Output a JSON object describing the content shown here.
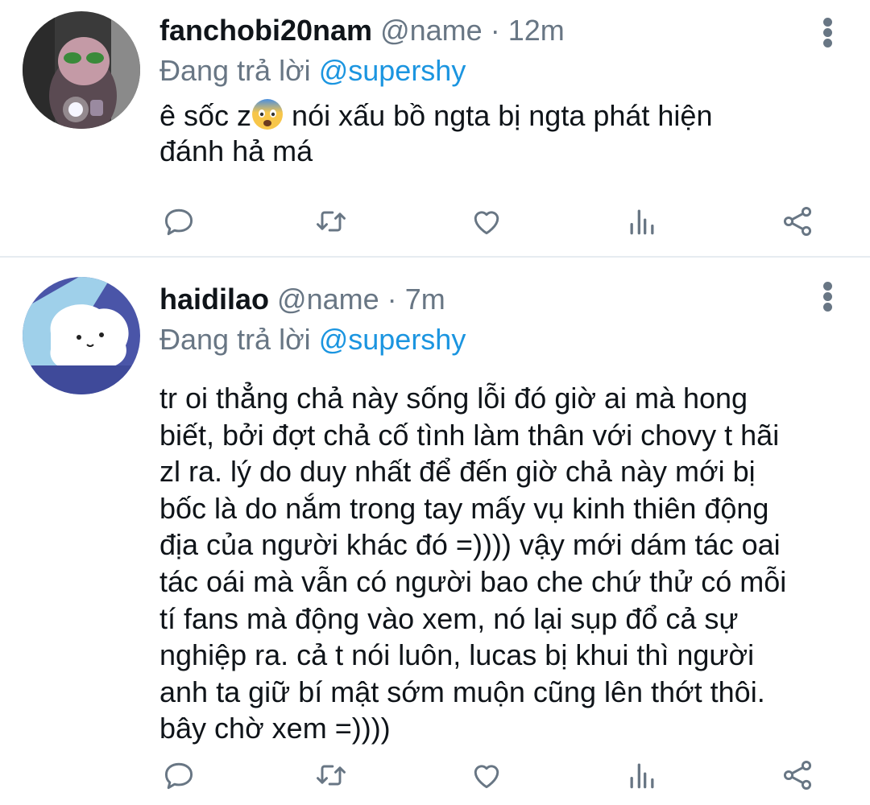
{
  "tweets": [
    {
      "username": "fanchobi20nam",
      "handle": "@name",
      "separator": "·",
      "time": "12m",
      "replying_prefix": "Đang trả lời",
      "replying_to": "@supershy",
      "text_before_emoji": "ê sốc z",
      "emoji": "fearful-face-emoji",
      "text_after_emoji": " nói xấu bồ ngta bị ngta phát hiện\nđánh hả má"
    },
    {
      "username": "haidilao",
      "handle": "@name",
      "separator": "·",
      "time": "7m",
      "replying_prefix": "Đang trả lời",
      "replying_to": "@supershy",
      "text": "tr oi thẳng chả này sống lỗi đó giờ ai mà hong\nbiết, bởi đợt chả cố tình làm thân với chovy t hãi\nzl ra. lý do duy nhất để đến giờ chả này mới bị\nbốc là do nắm trong tay mấy vụ kinh thiên động\nđịa của người khác đó =)))) vậy mới dám tác oai\ntác oái mà vẫn có người bao che chứ thử có mỗi\ntí fans mà động vào xem, nó lại sụp đổ cả sự\nnghiệp ra. cả t nói luôn, lucas bị khui thì người\nanh ta giữ bí mật sớm muộn cũng lên thớt thôi.\nbây chờ xem =))))"
    }
  ],
  "actions": [
    "reply-icon",
    "retweet-icon",
    "like-icon",
    "analytics-icon",
    "share-icon"
  ],
  "colors": {
    "text": "#0f1419",
    "secondary": "#687684",
    "mention": "#1b95e0",
    "divider": "#e6ecf0"
  }
}
